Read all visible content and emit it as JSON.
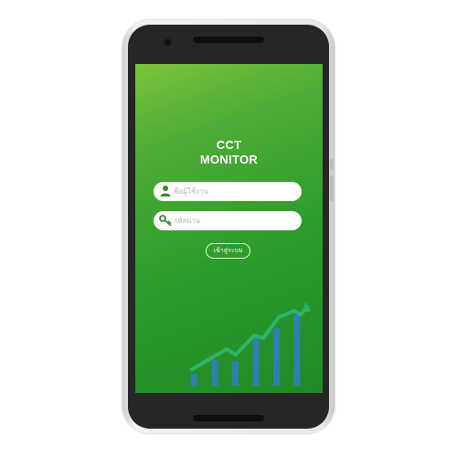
{
  "app": {
    "title_line1": "CCT",
    "title_line2": "MONITOR"
  },
  "login": {
    "username_placeholder": "ชื่อผู้ใช้งาน",
    "username_value": "",
    "password_placeholder": "รหัสผ่าน",
    "password_value": "",
    "submit_label": "เข้าสู่ระบบ"
  },
  "icons": {
    "username": "user-icon",
    "password": "key-icon"
  },
  "colors": {
    "background_gradient_start": "#7dc33d",
    "background_gradient_end": "#1f8a25",
    "icon_green": "#2e8b2e",
    "bar_blue": "#2f7fb0",
    "trend_line": "#2fb36b"
  },
  "decoration": {
    "bar_levels": [
      0.13,
      0.28,
      0.27,
      0.52,
      0.63,
      0.8
    ]
  }
}
